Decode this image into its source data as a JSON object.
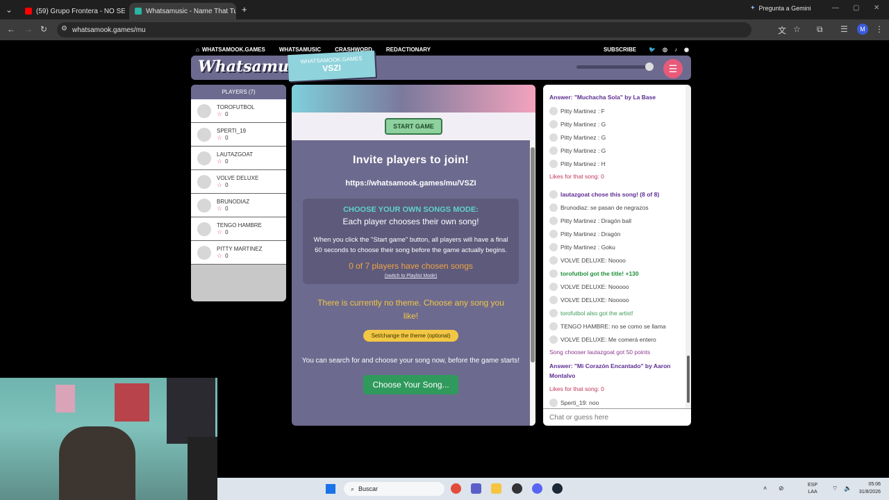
{
  "browser": {
    "tabs": [
      {
        "label": "(59) Grupo Frontera - NO SE V",
        "active": false,
        "favicon_color": "#ff0000"
      },
      {
        "label": "Whatsamusic - Name That Tun",
        "active": true,
        "favicon_color": "#2bb3a3"
      }
    ],
    "new_tab": "+",
    "gemini_label": "Pregunta a Gemini",
    "address": "whatsamook.games/mu",
    "profile_initial": "M"
  },
  "site": {
    "nav": [
      "WHATSAMOOK.GAMES",
      "WHATSAMUSIC",
      "CRASHWORD",
      "REDACTIONARY"
    ],
    "subscribe": "SUBSCRIBE",
    "logo": "Whatsamusic",
    "room_label": "WHATSAMOOK.GAMES",
    "room_code": "VSZI",
    "accent": "#6d6a8f",
    "volume_level": 0.95
  },
  "players": {
    "header": "PLAYERS (7)",
    "list": [
      {
        "name": "TOROFUTBOL",
        "score": "0"
      },
      {
        "name": "SPERTI_19",
        "score": "0"
      },
      {
        "name": "LAUTAZGOAT",
        "score": "0"
      },
      {
        "name": "VOLVE DELUXE",
        "score": "0"
      },
      {
        "name": "BRUNODIAZ",
        "score": "0"
      },
      {
        "name": "TENGO HAMBRE",
        "score": "0"
      },
      {
        "name": "PITTY MARTINEZ",
        "score": "0"
      }
    ]
  },
  "main": {
    "start_button": "START GAME",
    "invite_title": "Invite players to join!",
    "invite_url": "https://whatsamook.games/mu/VSZI",
    "mode_title": "CHOOSE YOUR OWN SONGS MODE:",
    "mode_subtitle": "Each player chooses their own song!",
    "mode_desc": "When you click the \"Start game\" button, all players will have a final 60 seconds to choose their song before the game actually begins.",
    "chosen_count": "0 of 7 players have chosen songs",
    "switch_link": "(switch to Playlist Mode)",
    "theme_text": "There is currently no theme. Choose any song you like!",
    "theme_button": "Set/change the theme (optional)",
    "search_note": "You can search for and choose your song now, before the game starts!",
    "choose_button": "Choose Your Song..."
  },
  "chat": {
    "messages": [
      {
        "type": "answer",
        "text": "Answer: \"Muchacha Sola\" by La Base"
      },
      {
        "type": "msg",
        "text": "Pitty Martinez : F"
      },
      {
        "type": "msg",
        "text": "Pitty Martinez : G"
      },
      {
        "type": "msg",
        "text": "Pitty Martinez : G"
      },
      {
        "type": "msg",
        "text": "Pitty Martinez : G"
      },
      {
        "type": "msg",
        "text": "Pitty Martinez : H"
      },
      {
        "type": "likes",
        "text": "Likes for that song: 0"
      },
      {
        "type": "chose",
        "text": "lautazgoat chose this song! (8 of 8)"
      },
      {
        "type": "msg",
        "text": "Brunodiaz: se pasan de negrazos"
      },
      {
        "type": "msg",
        "text": "Pitty Martinez : Dragón ball"
      },
      {
        "type": "msg",
        "text": "Pitty Martinez : Dragón"
      },
      {
        "type": "msg",
        "text": "Pitty Martinez : Goku"
      },
      {
        "type": "msg",
        "text": "VOLVE DELUXE: Noooo"
      },
      {
        "type": "gotit",
        "text": "torofutbol got the title! +130"
      },
      {
        "type": "msg",
        "text": "VOLVE DELUXE: Nooooo"
      },
      {
        "type": "msg",
        "text": "VOLVE DELUXE: Nooooo"
      },
      {
        "type": "artist",
        "text": "torofutbol also got the artist!"
      },
      {
        "type": "msg",
        "text": "TENGO HAMBRE: no se como se llama"
      },
      {
        "type": "msg",
        "text": "VOLVE DELUXE: Me comerá entero"
      },
      {
        "type": "chooser",
        "text": "Song chooser lautazgoat got 50 points"
      },
      {
        "type": "answer",
        "text": "Answer: \"Mi Corazón Encantado\" by Aaron Montalvo"
      },
      {
        "type": "likes",
        "text": "Likes for that song: 0"
      },
      {
        "type": "msg",
        "text": "Sperti_19: noo"
      }
    ],
    "input_placeholder": "Chat or guess here"
  },
  "taskbar": {
    "search_label": "Buscar",
    "lang_top": "ESP",
    "lang_bottom": "LAA",
    "time": "05:06",
    "date": "31/8/2026"
  }
}
